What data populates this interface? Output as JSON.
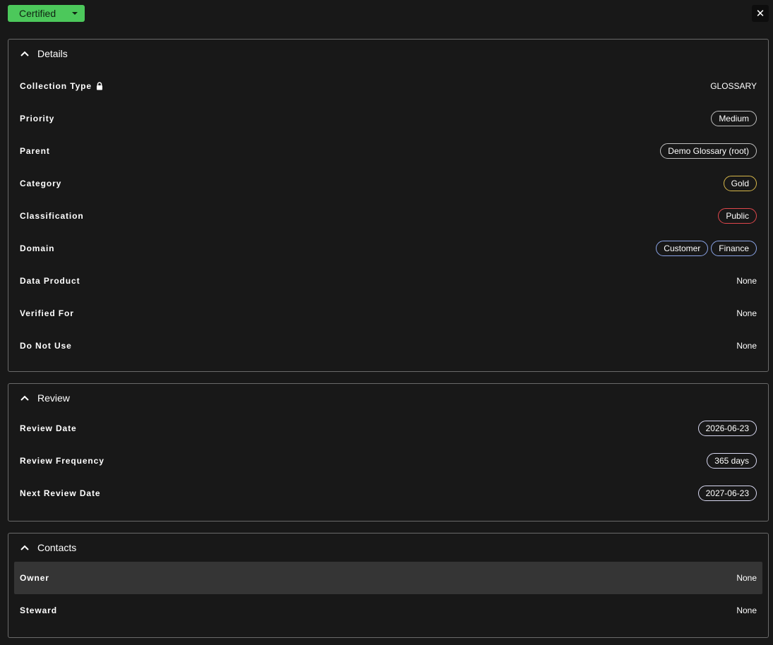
{
  "toolbar": {
    "status_label": "Certified",
    "status_color": "#4cc85b",
    "close_label": "✕"
  },
  "details": {
    "title": "Details",
    "collection_type": {
      "label": "Collection Type",
      "value": "GLOSSARY"
    },
    "priority": {
      "label": "Priority",
      "value": "Medium"
    },
    "parent": {
      "label": "Parent",
      "value": "Demo Glossary (root)"
    },
    "category": {
      "label": "Category",
      "value": "Gold",
      "color": "#d7b84a"
    },
    "classification": {
      "label": "Classification",
      "value": "Public",
      "color": "#e0474c"
    },
    "domain": {
      "label": "Domain",
      "values": [
        "Customer",
        "Finance"
      ],
      "color": "#8ba4e8"
    },
    "data_product": {
      "label": "Data Product",
      "value": "None"
    },
    "verified_for": {
      "label": "Verified For",
      "value": "None"
    },
    "do_not_use": {
      "label": "Do Not Use",
      "value": "None"
    }
  },
  "review": {
    "title": "Review",
    "review_date": {
      "label": "Review Date",
      "value": "2026-06-23"
    },
    "review_frequency": {
      "label": "Review Frequency",
      "value": "365 days"
    },
    "next_review_date": {
      "label": "Next Review Date",
      "value": "2027-06-23"
    }
  },
  "contacts": {
    "title": "Contacts",
    "owner": {
      "label": "Owner",
      "value": "None"
    },
    "steward": {
      "label": "Steward",
      "value": "None"
    }
  },
  "icons": {
    "chevron": "chevron-up-icon",
    "lock": "lock-icon",
    "caret": "caret-down-icon",
    "close": "close-icon"
  }
}
